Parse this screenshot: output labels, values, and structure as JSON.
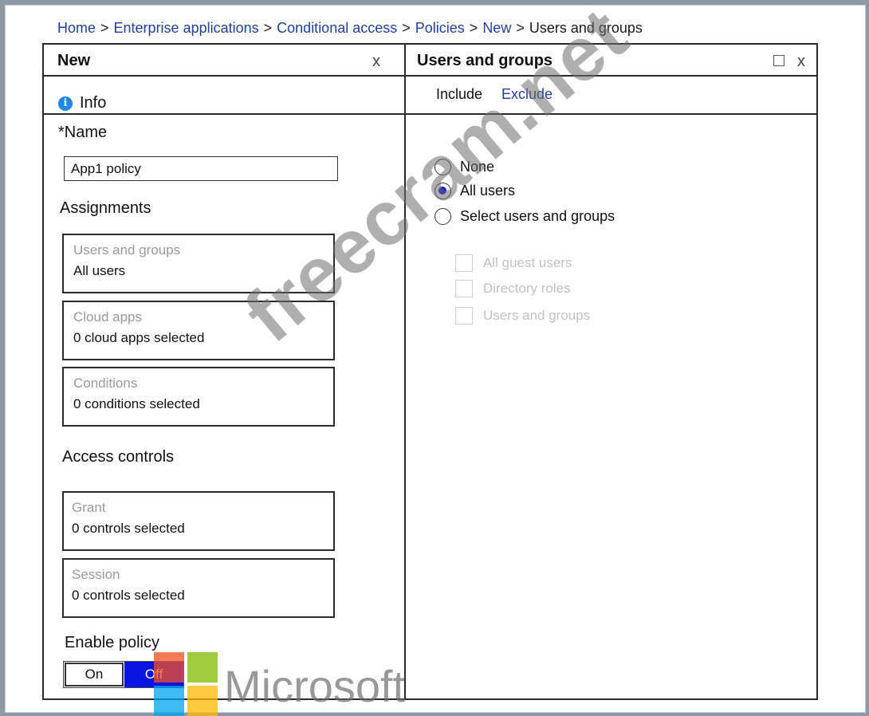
{
  "breadcrumb": {
    "items": [
      "Home",
      "Enterprise applications",
      "Conditional access",
      "Policies",
      "New",
      "Users and groups"
    ],
    "separator": ">"
  },
  "left_blade": {
    "title": "New",
    "close": "x",
    "info": "Info",
    "name_label": "*Name",
    "name_value": "App1 policy",
    "assignments_heading": "Assignments",
    "cards": [
      {
        "caption": "Users and groups",
        "value": "All users"
      },
      {
        "caption": "Cloud apps",
        "value": "0 cloud apps selected"
      },
      {
        "caption": "Conditions",
        "value": "0 conditions selected"
      }
    ],
    "access_controls_heading": "Access controls",
    "controls": [
      {
        "caption": "Grant",
        "value": "0 controls selected"
      },
      {
        "caption": "Session",
        "value": "0 controls selected"
      }
    ],
    "enable_policy_label": "Enable policy",
    "toggle": {
      "on": "On",
      "off": "Off",
      "selected": "Off"
    }
  },
  "right_blade": {
    "title": "Users and groups",
    "close": "x",
    "tabs": [
      "Include",
      "Exclude"
    ],
    "radios": [
      {
        "label": "None",
        "checked": false
      },
      {
        "label": "All users",
        "checked": true
      },
      {
        "label": "Select users and groups",
        "checked": false
      }
    ],
    "checkboxes": [
      {
        "label": "All guest users",
        "disabled": true
      },
      {
        "label": "Directory roles",
        "disabled": true
      },
      {
        "label": "Users and groups",
        "disabled": true
      }
    ]
  },
  "watermark": "freecram.net",
  "logo": {
    "text": "Microsoft",
    "colors": [
      "#f25022",
      "#7fba00",
      "#00a4ef",
      "#ffb900"
    ]
  },
  "colors": {
    "link": "#1f3f9a",
    "accent_blue": "#0a14e0",
    "info_blue": "#1a8ae6"
  }
}
